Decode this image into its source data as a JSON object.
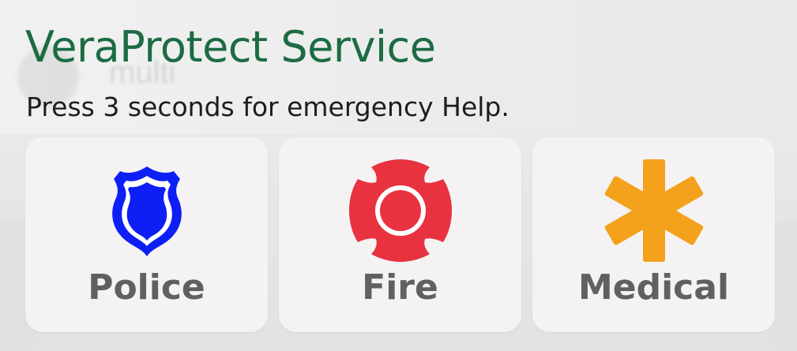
{
  "background": {
    "ghost_text": "multi"
  },
  "header": {
    "title": "VeraProtect Service",
    "subtitle": "Press 3 seconds for emergency Help."
  },
  "emergency_buttons": [
    {
      "label": "Police",
      "icon": "police-shield-icon",
      "color": "#0d1ff5"
    },
    {
      "label": "Fire",
      "icon": "fire-cross-icon",
      "color": "#e8323f"
    },
    {
      "label": "Medical",
      "icon": "medical-star-icon",
      "color": "#f4a11b"
    }
  ],
  "colors": {
    "title": "#1c6b43",
    "card_bg": "#f4f2f3",
    "label": "#606060"
  }
}
